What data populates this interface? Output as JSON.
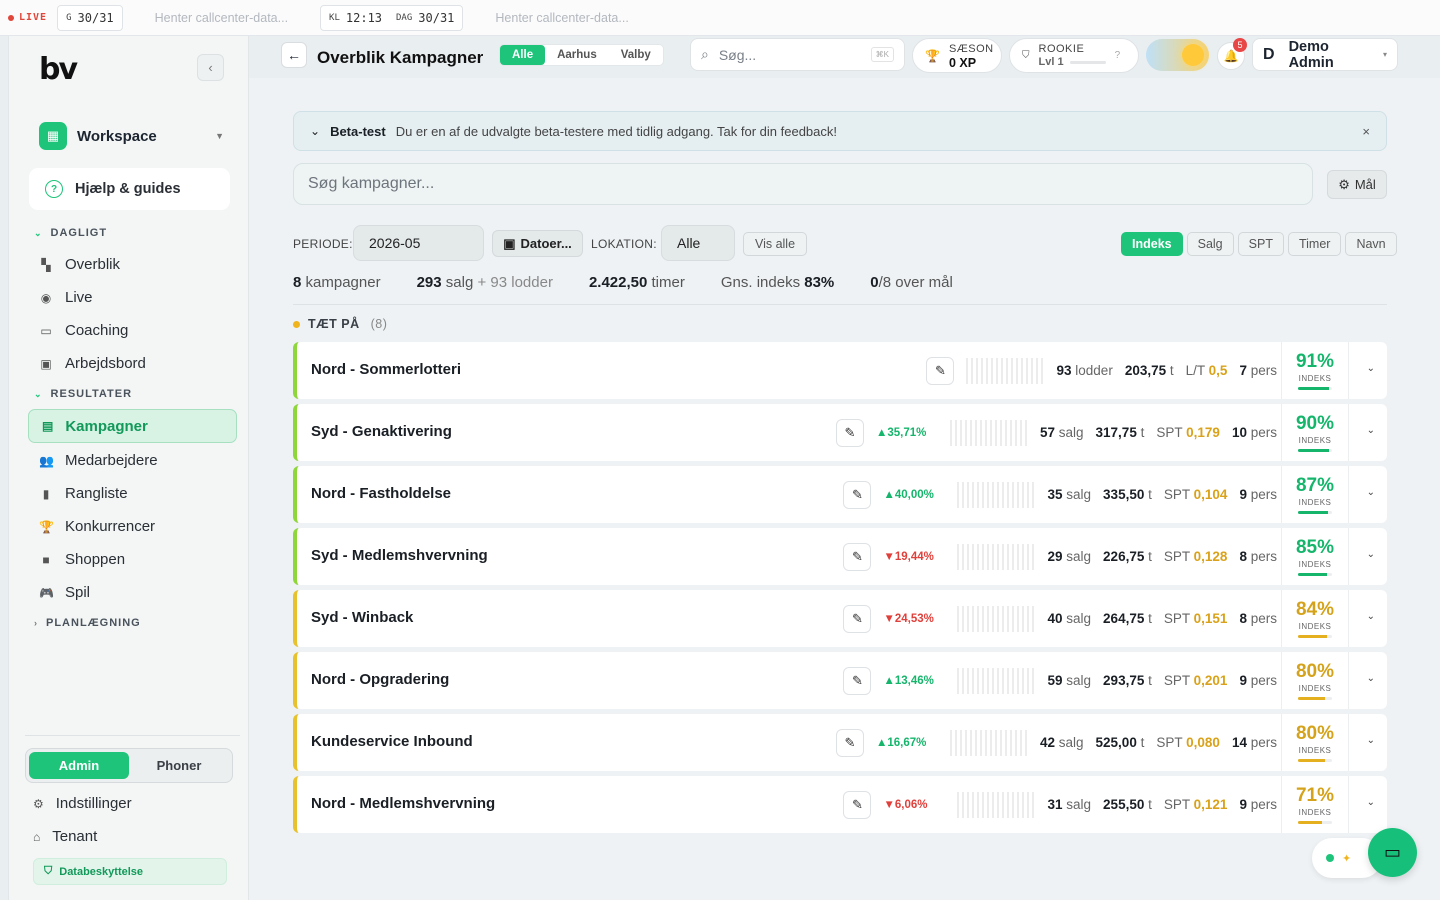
{
  "ticker": {
    "live_label": "LIVE",
    "box1": {
      "key": "G",
      "value": "30/31"
    },
    "loading1": "Henter callcenter-data...",
    "box2": {
      "key1": "KL",
      "value1": "12:13",
      "key2": "DAG",
      "value2": "30/31"
    },
    "loading2": "Henter callcenter-data..."
  },
  "sidebar": {
    "logo": "bv",
    "workspace": "Workspace",
    "help": "Hjælp & guides",
    "section_daily": "DAGLIGT",
    "daily_items": [
      "Overblik",
      "Live",
      "Coaching",
      "Arbejdsbord"
    ],
    "section_results": "RESULTATER",
    "active_item": "Kampagner",
    "result_items": [
      "Medarbejdere",
      "Rangliste",
      "Konkurrencer",
      "Shoppen",
      "Spil"
    ],
    "section_planning": "PLANLÆGNING",
    "roles": {
      "admin": "Admin",
      "phoner": "Phoner"
    },
    "bottom_items": [
      "Indstillinger",
      "Tenant"
    ],
    "privacy": "Databeskyttelse"
  },
  "topbar": {
    "title": "Overblik Kampagner",
    "location_tabs": [
      "Alle",
      "Aarhus",
      "Valby"
    ],
    "search_placeholder": "Søg...",
    "search_kbd": "⌘K",
    "season": {
      "label": "SÆSON",
      "value": "0 XP"
    },
    "rookie": {
      "label": "ROOKIE",
      "value": "Lvl 1",
      "help": "?"
    },
    "notif_count": "5",
    "user_initial": "D",
    "user_name": "Demo Admin"
  },
  "banner": {
    "title": "Beta-test",
    "text": "Du er en af de udvalgte beta-testere med tidlig adgang. Tak for din feedback!"
  },
  "filters": {
    "search_placeholder": "Søg kampagner...",
    "goal_btn": "Mål",
    "period_label": "PERIODE:",
    "period_value": "2026-05",
    "dates_btn": "Datoer...",
    "location_label": "LOKATION:",
    "location_value": "Alle",
    "show_all": "Vis alle",
    "sort_tabs": [
      "Indeks",
      "Salg",
      "SPT",
      "Timer",
      "Navn"
    ]
  },
  "stats": {
    "campaigns_n": "8",
    "campaigns_label": "kampagner",
    "sales_n": "293",
    "sales_label": "salg",
    "lodder_text": "+ 93 lodder",
    "hours_n": "2.422,50",
    "hours_label": "timer",
    "avg_label": "Gns. indeks",
    "avg_value": "83%",
    "over_n": "0",
    "over_label": "/8 over mål"
  },
  "group": {
    "label": "TÆT PÅ",
    "count": "(8)"
  },
  "campaigns": [
    {
      "name": "Nord - Sommerlotteri",
      "trend": "",
      "qty": "93",
      "qty_unit": "lodder",
      "hours": "203,75",
      "hours_unit": "t",
      "ratio_label": "L/T",
      "ratio": "0,5",
      "pers": "7",
      "pers_unit": "pers",
      "index": "91%",
      "index_label": "INDEKS",
      "index_frac": 0.91,
      "accent": "green"
    },
    {
      "name": "Syd - Genaktivering",
      "trend": "▲35,71%",
      "qty": "57",
      "qty_unit": "salg",
      "hours": "317,75",
      "hours_unit": "t",
      "ratio_label": "SPT",
      "ratio": "0,179",
      "pers": "10",
      "pers_unit": "pers",
      "index": "90%",
      "index_label": "INDEKS",
      "index_frac": 0.9,
      "accent": "green"
    },
    {
      "name": "Nord - Fastholdelse",
      "trend": "▲40,00%",
      "qty": "35",
      "qty_unit": "salg",
      "hours": "335,50",
      "hours_unit": "t",
      "ratio_label": "SPT",
      "ratio": "0,104",
      "pers": "9",
      "pers_unit": "pers",
      "index": "87%",
      "index_label": "INDEKS",
      "index_frac": 0.87,
      "accent": "green"
    },
    {
      "name": "Syd - Medlemshvervning",
      "trend": "▼19,44%",
      "qty": "29",
      "qty_unit": "salg",
      "hours": "226,75",
      "hours_unit": "t",
      "ratio_label": "SPT",
      "ratio": "0,128",
      "pers": "8",
      "pers_unit": "pers",
      "index": "85%",
      "index_label": "INDEKS",
      "index_frac": 0.85,
      "accent": "green"
    },
    {
      "name": "Syd - Winback",
      "trend": "▼24,53%",
      "qty": "40",
      "qty_unit": "salg",
      "hours": "264,75",
      "hours_unit": "t",
      "ratio_label": "SPT",
      "ratio": "0,151",
      "pers": "8",
      "pers_unit": "pers",
      "index": "84%",
      "index_label": "INDEKS",
      "index_frac": 0.84,
      "accent": "yellow"
    },
    {
      "name": "Nord - Opgradering",
      "trend": "▲13,46%",
      "qty": "59",
      "qty_unit": "salg",
      "hours": "293,75",
      "hours_unit": "t",
      "ratio_label": "SPT",
      "ratio": "0,201",
      "pers": "9",
      "pers_unit": "pers",
      "index": "80%",
      "index_label": "INDEKS",
      "index_frac": 0.8,
      "accent": "yellow"
    },
    {
      "name": "Kundeservice Inbound",
      "trend": "▲16,67%",
      "qty": "42",
      "qty_unit": "salg",
      "hours": "525,00",
      "hours_unit": "t",
      "ratio_label": "SPT",
      "ratio": "0,080",
      "pers": "14",
      "pers_unit": "pers",
      "index": "80%",
      "index_label": "INDEKS",
      "index_frac": 0.8,
      "accent": "yellow"
    },
    {
      "name": "Nord - Medlemshvervning",
      "trend": "▼6,06%",
      "qty": "31",
      "qty_unit": "salg",
      "hours": "255,50",
      "hours_unit": "t",
      "ratio_label": "SPT",
      "ratio": "0,121",
      "pers": "9",
      "pers_unit": "pers",
      "index": "71%",
      "index_label": "INDEKS",
      "index_frac": 0.71,
      "accent": "yellow"
    }
  ],
  "colors": {
    "accent_green": "#1ec47a",
    "index_yellow": "#d4a31b",
    "trend_up": "#16b56c",
    "trend_down": "#e0403b"
  }
}
